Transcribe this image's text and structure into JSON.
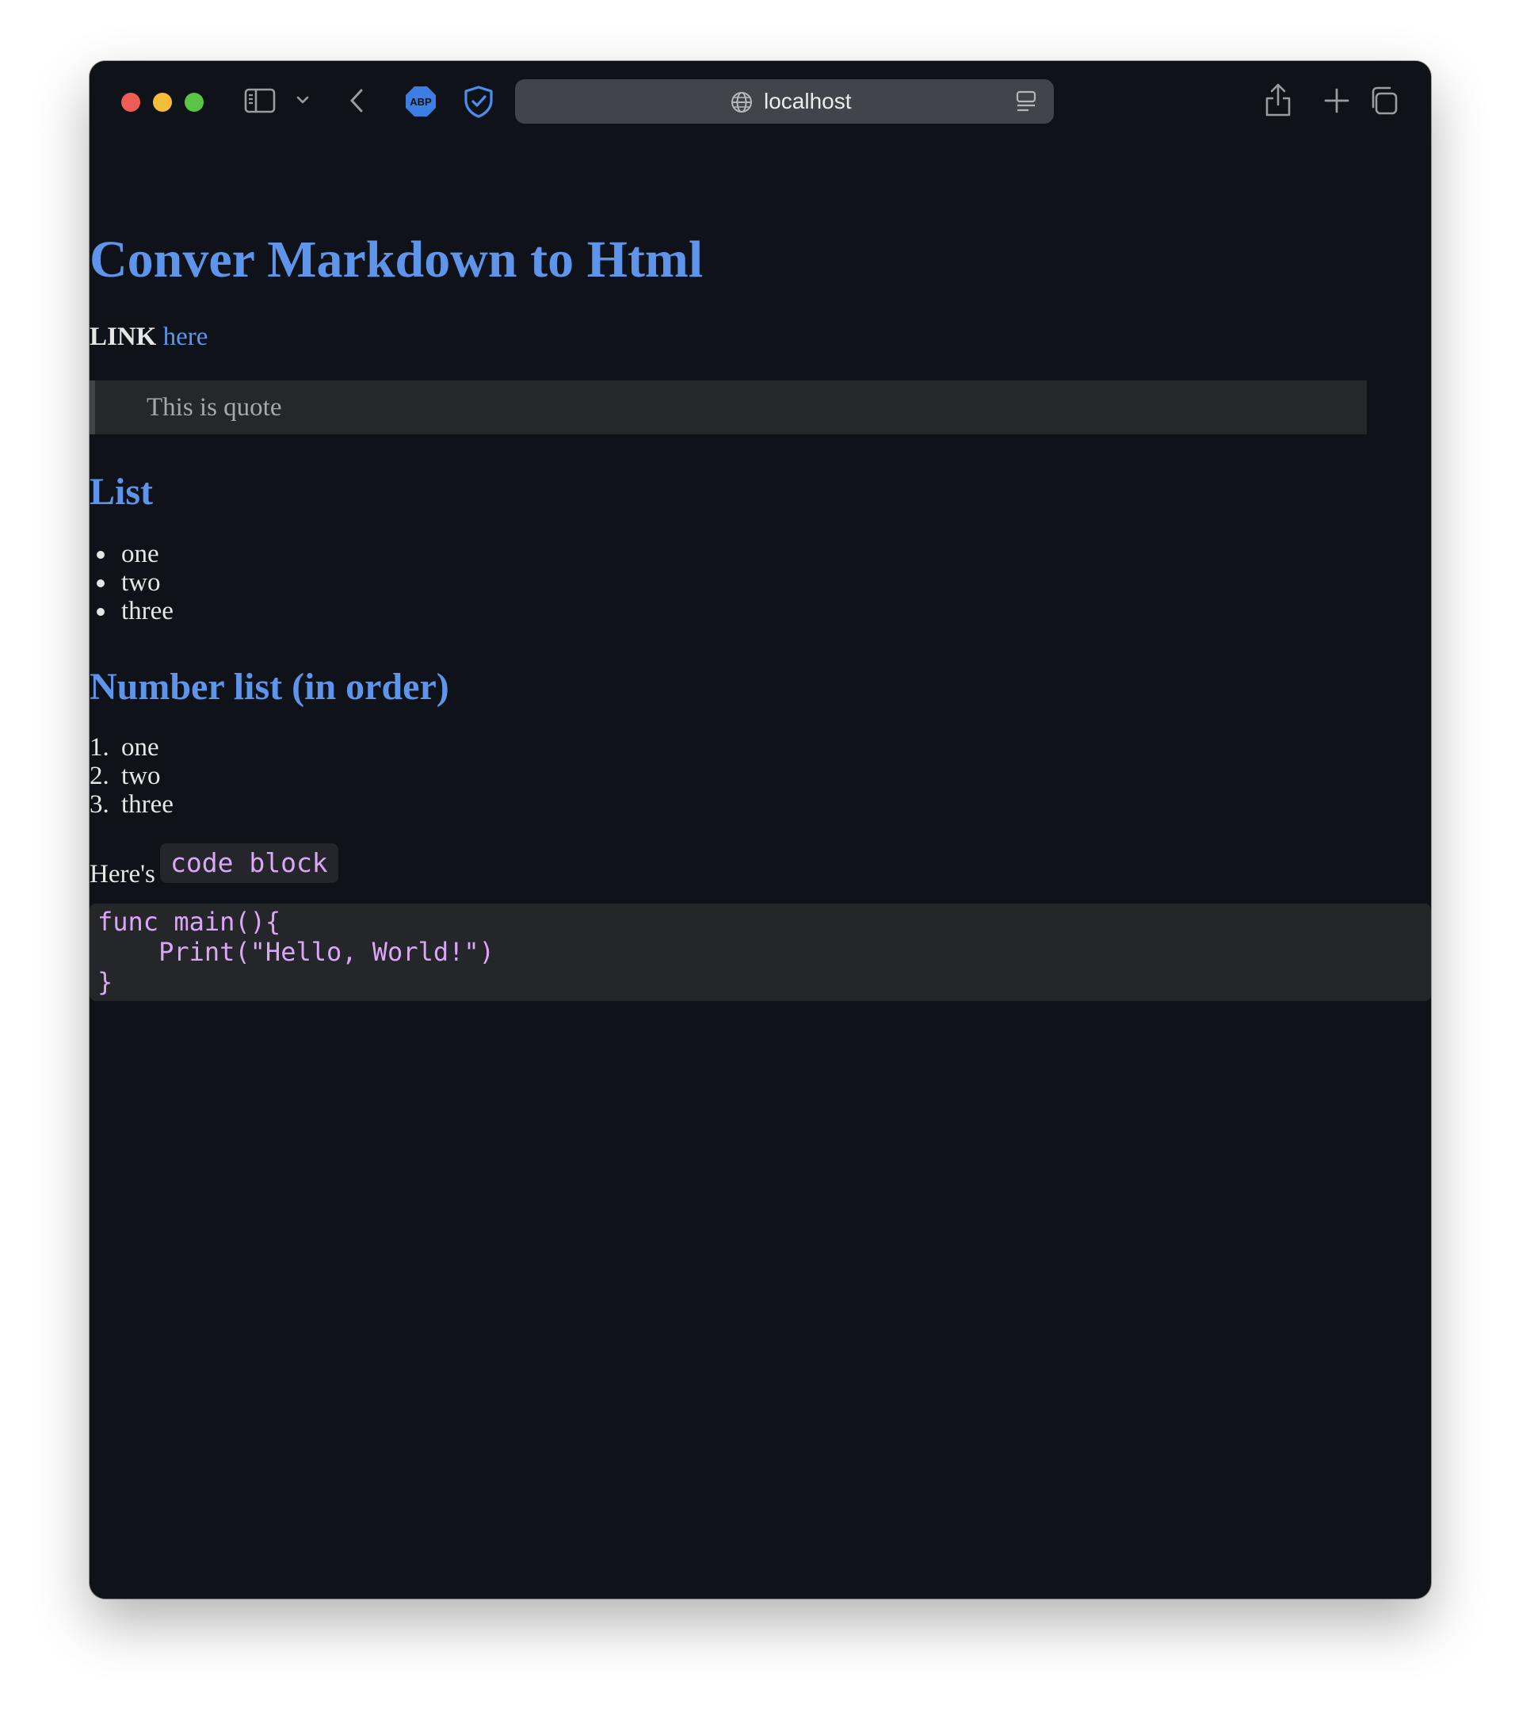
{
  "browser": {
    "address": "localhost",
    "icons": {
      "sidebar": "sidebar-toggle-icon",
      "chevron": "chevron-down-icon",
      "back": "back-arrow-icon",
      "abp": "ABP",
      "shield": "shield-check-icon",
      "globe": "globe-icon",
      "reader": "reader-icon",
      "share": "share-icon",
      "new_tab": "plus-icon",
      "tabs": "tab-overview-icon"
    }
  },
  "page": {
    "title": "Conver Markdown to Html",
    "link_label": "LINK",
    "link_text": "here",
    "quote": "This is quote",
    "list_heading": "List",
    "list_items": [
      "one",
      "two",
      "three"
    ],
    "number_heading": "Number list (in order)",
    "number_items": [
      {
        "num": "1.",
        "text": "one"
      },
      {
        "num": "2.",
        "text": "two"
      },
      {
        "num": "3.",
        "text": "three"
      }
    ],
    "code_intro": "Here's",
    "inline_code": "code block",
    "code_lines": [
      "func main(){",
      "    Print(\"Hello, World!\")",
      "}"
    ]
  },
  "colors": {
    "background": "#0f1218",
    "heading": "#5e95ea",
    "code_text": "#d9a7f5"
  }
}
